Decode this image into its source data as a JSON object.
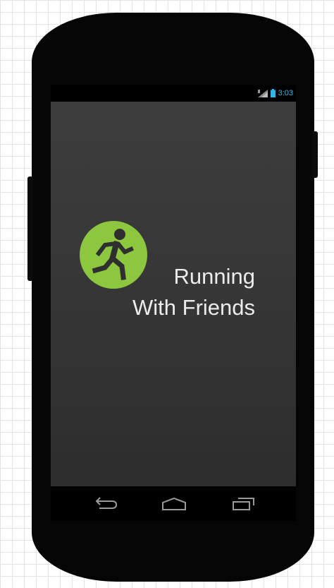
{
  "status_bar": {
    "time": "3:03",
    "signal_icon": "signal-icon",
    "battery_icon": "battery-icon",
    "time_color": "#33b5e5"
  },
  "screen": {
    "background": "#3a3a3a"
  },
  "app": {
    "title_line1": "Running",
    "title_line2": "With Friends",
    "logo_icon": "runner-icon",
    "logo_color": "#8dc63f"
  },
  "nav_bar": {
    "back_icon": "back-icon",
    "home_icon": "home-icon",
    "recent_icon": "recent-apps-icon"
  }
}
